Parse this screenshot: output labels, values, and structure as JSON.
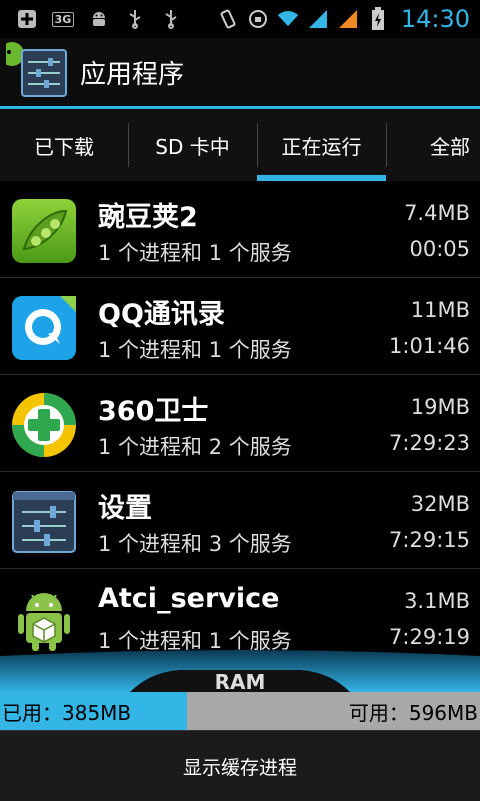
{
  "status_bar": {
    "network": "3G",
    "time": "14:30"
  },
  "action_bar": {
    "title": "应用程序"
  },
  "tabs": [
    {
      "label": "已下载",
      "active": false
    },
    {
      "label": "SD 卡中",
      "active": false
    },
    {
      "label": "正在运行",
      "active": true
    },
    {
      "label": "全部",
      "active": false
    }
  ],
  "apps": [
    {
      "name": "豌豆荚2",
      "detail": "1 个进程和 1 个服务",
      "size": "7.4MB",
      "time": "00:05",
      "icon": "wandoujia-icon"
    },
    {
      "name": "QQ通讯录",
      "detail": "1 个进程和 1 个服务",
      "size": "11MB",
      "time": "1:01:46",
      "icon": "qq-contacts-icon"
    },
    {
      "name": " 360卫士",
      "detail": "1 个进程和 2 个服务",
      "size": "19MB",
      "time": "7:29:23",
      "icon": "360-security-icon"
    },
    {
      "name": "设置",
      "detail": "1 个进程和 3 个服务",
      "size": "32MB",
      "time": "7:29:15",
      "icon": "settings-icon"
    },
    {
      "name": "Atci_service",
      "detail": "1 个进程和 1 个服务",
      "size": "3.1MB",
      "time": "7:29:19",
      "icon": "android-service-icon"
    }
  ],
  "ram": {
    "label": "RAM",
    "used_text": "已用：385MB",
    "free_text": "可用：596MB",
    "used_fraction": 0.39
  },
  "bottom": {
    "button_label": "显示缓存进程"
  },
  "colors": {
    "accent": "#33b5e5",
    "ram_free": "#a8a8a8"
  }
}
